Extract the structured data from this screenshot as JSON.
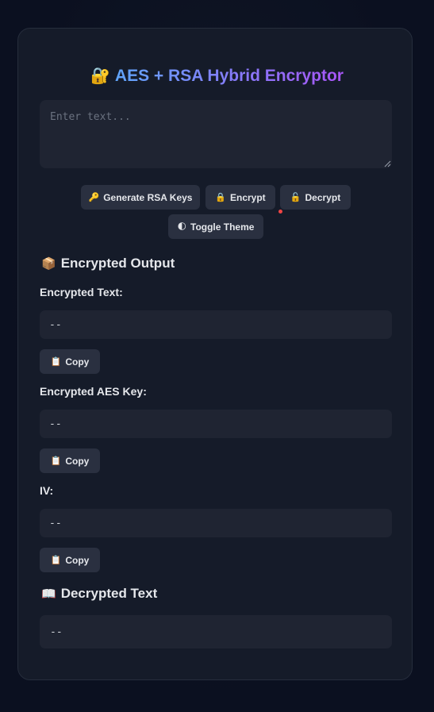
{
  "header": {
    "title_icon": "🔐",
    "title": "AES + RSA Hybrid Encryptor"
  },
  "input": {
    "placeholder": "Enter text...",
    "value": ""
  },
  "actions": {
    "generate_icon": "🔑",
    "generate_label": "Generate RSA Keys",
    "encrypt_icon": "🔒",
    "encrypt_label": "Encrypt",
    "decrypt_icon": "🔓",
    "decrypt_label": "Decrypt",
    "theme_icon": "🌓",
    "theme_label": "Toggle Theme"
  },
  "encrypted_output": {
    "heading_icon": "📦",
    "heading": "Encrypted Output",
    "fields": [
      {
        "label": "Encrypted Text:",
        "value": "--",
        "copy_icon": "📋",
        "copy_label": "Copy"
      },
      {
        "label": "Encrypted AES Key:",
        "value": "--",
        "copy_icon": "📋",
        "copy_label": "Copy"
      },
      {
        "label": "IV:",
        "value": "--",
        "copy_icon": "📋",
        "copy_label": "Copy"
      }
    ]
  },
  "decrypted": {
    "heading_icon": "📖",
    "heading": "Decrypted Text",
    "value": "--"
  },
  "colors": {
    "background": "#0b1020",
    "card": "#151b29",
    "field": "#1f2432",
    "button": "#2a3040",
    "title_gradient_start": "#60a5fa",
    "title_gradient_end": "#a855f7"
  }
}
